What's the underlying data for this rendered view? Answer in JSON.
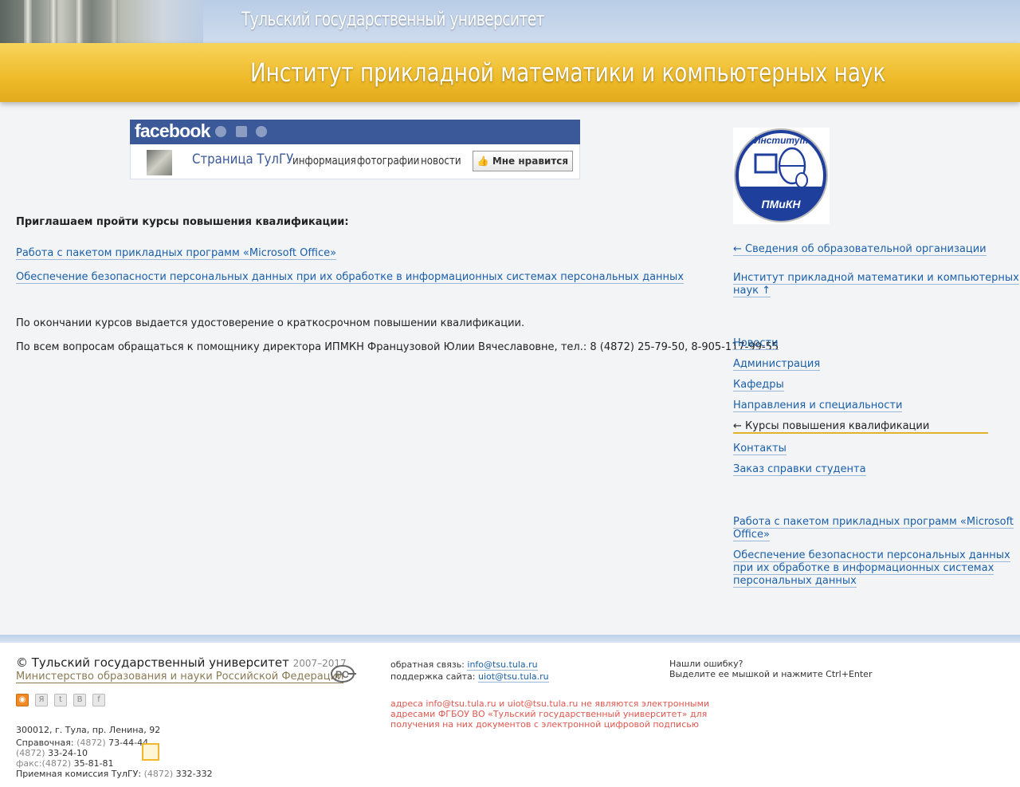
{
  "header": {
    "university": "Тульский государственный университет",
    "institute": "Институт прикладной математики и компьютерных наук"
  },
  "facebook": {
    "logo": "facebook",
    "page_name": "Страница ТулГУ",
    "tabs": [
      "информация",
      "фотографии",
      "новости"
    ],
    "like_label": "Мне нравится",
    "brand_color": "#3b5998"
  },
  "main": {
    "intro": "Приглашаем пройти курсы повышения квалификации:",
    "courses": [
      "Работа с пакетом прикладных программ «Microsoft Office»",
      "Обеспечение безопасности персональных данных при их обработке в информационных системах персональных данных"
    ],
    "note1": "По окончании курсов выдается удостоверение о краткосрочном повышении квалификации.",
    "note2": "По всем вопросам обращаться к помощнику директора ИПМКН Французовой Юлии Вячеславовне, тел.: 8 (4872) 25-79-50, 8-905-117-99-55"
  },
  "sidebar": {
    "logo_top": "Институт",
    "logo_bottom": "ПМиКН",
    "back_link": "← Сведения об образовательной организации",
    "parent_line1": "Институт прикладной математики и компьютерных",
    "parent_line2": "наук ↑",
    "menu": [
      "Новости",
      "Администрация",
      "Кафедры",
      "Направления и специальности",
      "← Курсы повышения квалификации",
      "Контакты",
      "Заказ справки студента"
    ],
    "sub1_line1": "Работа с пакетом прикладных программ «Microsoft",
    "sub1_line2": "Office»",
    "sub2_line1": "Обеспечение безопасности персональных данных",
    "sub2_line2": "при их обработке в информационных системах",
    "sub2_line3": "персональных данных",
    "accent_color": "#e2b32a"
  },
  "footer": {
    "copyright": "© Тульский государственный университет",
    "years": "2007–2017",
    "ministry": "Министерство образования и науки Российской Федерации",
    "feedback_label": "обратная связь:",
    "feedback_email": "info@tsu.tula.ru",
    "support_label": "поддержка сайта:",
    "support_email": "uiot@tsu.tula.ru",
    "warning_line1": "адреса info@tsu.tula.ru и uiot@tsu.tula.ru не являются электронными",
    "warning_line2": "адресами ФГБОУ ВО «Тульский государственный университет» для",
    "warning_line3": "получения на них документов с электронной цифровой подписью",
    "error_title": "Нашли ошибку?",
    "error_hint": "Выделите ее мышкой и нажмите Ctrl+Enter",
    "address": "300012, г. Тула, пр. Ленина, 92",
    "ref_label": "Справочная:",
    "ref_code": "(4872)",
    "ref_num": "73-44-44",
    "ref2_code": "(4872)",
    "ref2_num": "33-24-10",
    "fax_label": "факс:(4872)",
    "fax_num": "35-81-81",
    "adm_label": "Приемная комиссия ТулГУ:",
    "adm_code": "(4872)",
    "adm_num": "332-332",
    "social_icons": [
      "rss-icon",
      "yandex-icon",
      "twitter-icon",
      "vk-icon",
      "facebook-icon"
    ]
  }
}
